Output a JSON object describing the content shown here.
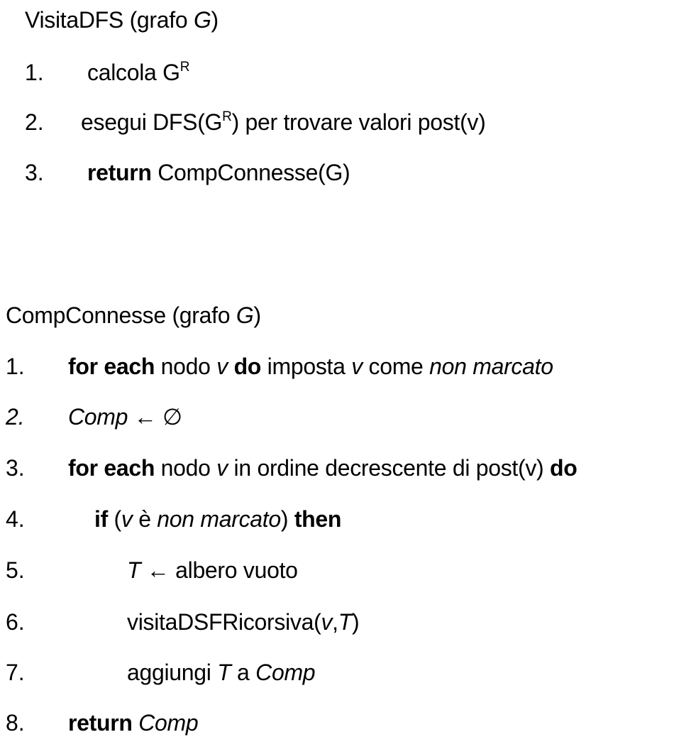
{
  "visita": {
    "title_name": "VisitaDFS (grafo ",
    "title_var": "G",
    "title_close": ")",
    "steps": [
      {
        "num": "1.",
        "text": "calcola G",
        "sup": "R"
      },
      {
        "num": "2.",
        "pre": "esegui DFS(G",
        "sup": "R",
        "post": ") per trovare valori post(v)"
      },
      {
        "num": "3.",
        "kw": "return",
        "text": " CompConnesse(G)"
      }
    ]
  },
  "comp": {
    "title_name": "CompConnesse (grafo ",
    "title_var": "G",
    "title_close": ")",
    "steps": [
      {
        "num": "1.",
        "kw1": "for each",
        "t1": " nodo ",
        "v1": "v",
        "t2": " ",
        "kw2": "do",
        "t3": " imposta ",
        "v2": "v",
        "t4": " come ",
        "v3": "non marcato"
      },
      {
        "num": "2.",
        "var": "Comp",
        "arrow": " ← ",
        "empty": "∅"
      },
      {
        "num": "3.",
        "kw1": "for each",
        "t1": " nodo ",
        "v1": "v",
        "t2": " in ordine decrescente di post(v) ",
        "kw2": "do"
      },
      {
        "num": "4.",
        "kw1": "if",
        "t1": " (",
        "v1": "v",
        "t2": " è ",
        "v2": "non marcato",
        "t3": ") ",
        "kw2": "then"
      },
      {
        "num": "5.",
        "var": "T",
        "text": " ← albero vuoto"
      },
      {
        "num": "6.",
        "pre": "visitaDSFRicorsiva(",
        "v1": "v",
        "comma": ",",
        "v2": "T",
        "post": ")"
      },
      {
        "num": "7.",
        "pre": "aggiungi ",
        "v1": "T",
        "mid": " a ",
        "v2": "Comp"
      },
      {
        "num": "8.",
        "kw": "return",
        "sp": " ",
        "var": "Comp"
      }
    ]
  }
}
